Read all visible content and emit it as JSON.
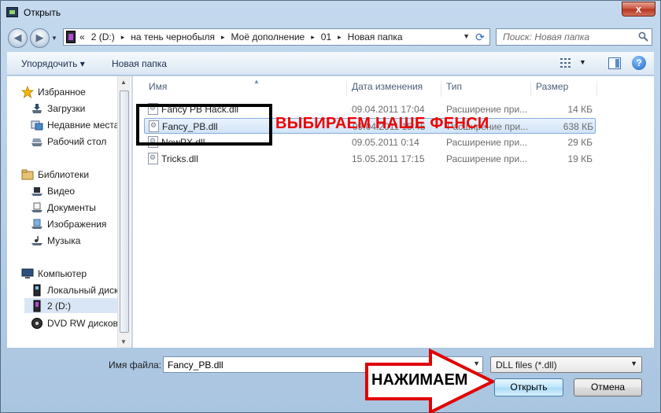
{
  "window": {
    "title": "Открыть",
    "close_glyph": "x"
  },
  "nav": {
    "back_glyph": "◀",
    "forward_glyph": "▶",
    "history_glyph": "▼"
  },
  "address": {
    "overflow_glyph": "«",
    "crumbs": [
      "2 (D:)",
      "на тень чернобыля",
      "Моё дополнение",
      "01",
      "Новая папка"
    ],
    "separator": "▸",
    "drop_glyph": "▼",
    "refresh_glyph": "⟳"
  },
  "search": {
    "placeholder": "Поиск: Новая папка"
  },
  "toolbar": {
    "organize_label": "Упорядочить ▾",
    "new_folder_label": "Новая папка",
    "view_drop_glyph": "▼",
    "help_glyph": "?"
  },
  "sidebar": {
    "items": [
      {
        "label": "Избранное",
        "icon": "star-icon"
      },
      {
        "label": "Загрузки",
        "icon": "downloads-icon"
      },
      {
        "label": "Недавние места",
        "icon": "recent-places-icon"
      },
      {
        "label": "Рабочий стол",
        "icon": "desktop-icon"
      },
      {
        "label": "Библиотеки",
        "icon": "libraries-icon"
      },
      {
        "label": "Видео",
        "icon": "video-icon"
      },
      {
        "label": "Документы",
        "icon": "documents-icon"
      },
      {
        "label": "Изображения",
        "icon": "pictures-icon"
      },
      {
        "label": "Музыка",
        "icon": "music-icon"
      },
      {
        "label": "Компьютер",
        "icon": "computer-icon"
      },
      {
        "label": "Локальный диск",
        "icon": "local-disk-icon"
      },
      {
        "label": "2 (D:)",
        "icon": "drive-d-icon"
      },
      {
        "label": "DVD RW дисково",
        "icon": "dvd-icon"
      }
    ],
    "scroll_up": "▲",
    "scroll_down": "▼"
  },
  "files": {
    "columns": [
      "Имя",
      "Дата изменения",
      "Тип",
      "Размер"
    ],
    "sort_glyph": "▲",
    "rows": [
      {
        "name": "Fancy PB Hack.dll",
        "date": "09.04.2011 17:04",
        "type": "Расширение при...",
        "size": "14 КБ"
      },
      {
        "name": "Fancy_PB.dll",
        "date": "09.04.2011 15:45",
        "type": "Расширение при...",
        "size": "638 КБ"
      },
      {
        "name": "NewPX.dll",
        "date": "09.05.2011 0:14",
        "type": "Расширение при...",
        "size": "29 КБ"
      },
      {
        "name": "Tricks.dll",
        "date": "15.05.2011 17:15",
        "type": "Расширение при...",
        "size": "19 КБ"
      }
    ]
  },
  "annotations": {
    "select_text": "ВЫБИРАЕМ НАШЕ ФЕНСИ",
    "press_text": "НАЖИМАЕМ"
  },
  "bottom": {
    "filename_label": "Имя файла:",
    "filename_value": "Fancy_PB.dll",
    "filter_value": "DLL files (*.dll)",
    "drop_glyph": "▼",
    "open_label": "Открыть",
    "cancel_label": "Отмена"
  },
  "colors": {
    "annotation_red": "#ee0000",
    "selection_border": "#84acdd",
    "window_frame": "#aac5e0"
  }
}
